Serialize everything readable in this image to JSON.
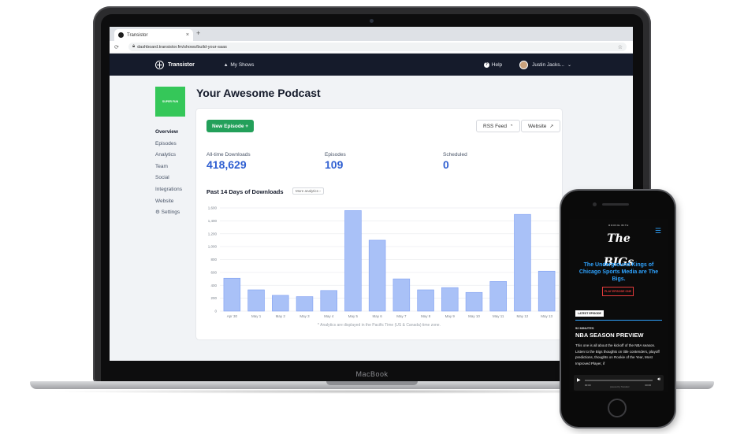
{
  "browser": {
    "tab_title": "Transistor",
    "close": "×",
    "new_tab": "+",
    "url": "dashboard.transistor.fm/shows/build-your-saas"
  },
  "app": {
    "brand": "Transistor",
    "my_shows": "My Shows",
    "help": "Help",
    "user_name": "Justin Jacks..."
  },
  "podcast": {
    "art_text": "SUPER FUN",
    "title": "Your Awesome Podcast"
  },
  "sidebar": {
    "items": [
      {
        "label": "Overview",
        "active": true
      },
      {
        "label": "Episodes"
      },
      {
        "label": "Analytics"
      },
      {
        "label": "Team"
      },
      {
        "label": "Social"
      },
      {
        "label": "Integrations"
      },
      {
        "label": "Website"
      },
      {
        "label": "Settings"
      }
    ]
  },
  "actions": {
    "new_episode": "New Episode  +",
    "rss_feed": "RSS Feed",
    "website": "Website"
  },
  "stats": {
    "downloads_label": "All-time Downloads",
    "downloads_value": "418,629",
    "episodes_label": "Episodes",
    "episodes_value": "109",
    "scheduled_label": "Scheduled",
    "scheduled_value": "0"
  },
  "chart_section": {
    "title": "Past 14 Days of Downloads",
    "more_analytics": "More analytics ›",
    "footnote": "* Analytics are displayed in the Pacific Time (US & Canada) time zone."
  },
  "chart_data": {
    "type": "bar",
    "title": "Past 14 Days of Downloads",
    "categories": [
      "Apr 30",
      "May 1",
      "May 2",
      "May 3",
      "May 4",
      "May 5",
      "May 6",
      "May 7",
      "May 8",
      "May 9",
      "May 10",
      "May 11",
      "May 12",
      "May 13"
    ],
    "values": [
      510,
      330,
      245,
      225,
      320,
      1560,
      1100,
      500,
      330,
      365,
      290,
      460,
      1500,
      620
    ],
    "ylim": [
      0,
      1600
    ],
    "yticks": [
      0,
      200,
      400,
      600,
      800,
      1000,
      1200,
      1400,
      1600
    ],
    "ytick_labels": [
      "0",
      "200",
      "400",
      "600",
      "800",
      "1,000",
      "1,200",
      "1,400",
      "1,600"
    ],
    "grid": true,
    "bar_color": "#a9c1f7",
    "bar_border": "#7f9ff2"
  },
  "phone": {
    "logo_top": "ROOKIE WITH",
    "logo": "The BIGs",
    "tagline": "The Underground Kings of Chicago Sports Media are The Bigs.",
    "play_button": "PLAY EPISODE ONE",
    "latest_label": "LATEST EPISODE",
    "duration": "52 MINUTES",
    "episode_title": "NBA SEASON PREVIEW",
    "description": "This one is all about the kickoff of the NBA season. Listen to the Bigs thoughts on title contenders, playoff predictions, thoughts on Rookie of the Year, Most Improved Player, if",
    "time_start": "00:00",
    "time_end": "00:00",
    "powered": "powered by Transistor"
  },
  "device": {
    "macbook_label": "MacBook"
  },
  "colors": {
    "primary_blue": "#2f5fd1",
    "green": "#23a05a",
    "header_navy": "#151b2b",
    "phone_accent": "#2fa3ff"
  }
}
